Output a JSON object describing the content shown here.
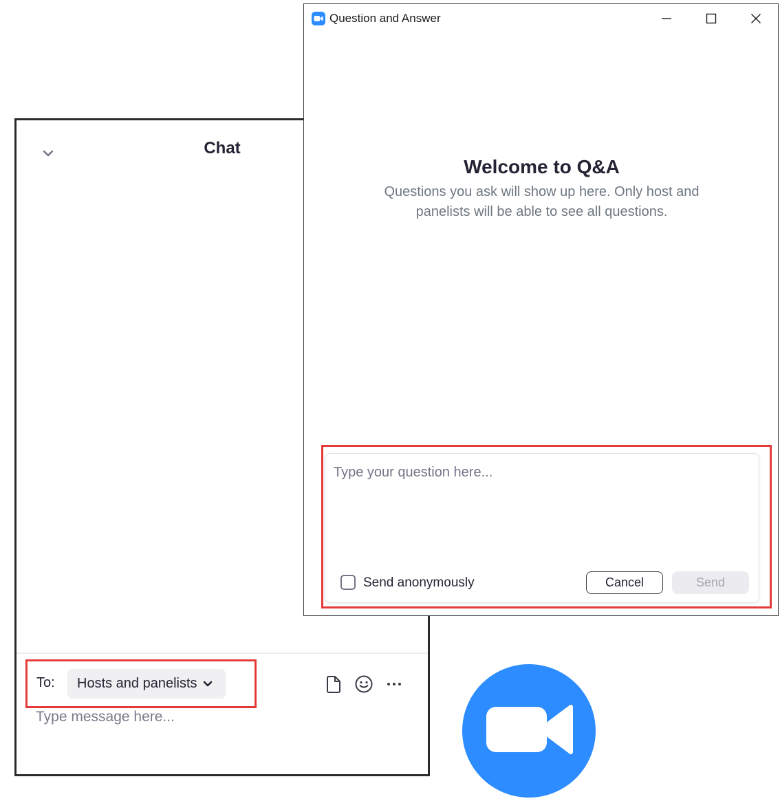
{
  "chat": {
    "title": "Chat",
    "to_label": "To:",
    "recipient": "Hosts and panelists",
    "input_placeholder": "Type message here..."
  },
  "qa": {
    "window_title": "Question and Answer",
    "welcome_title": "Welcome to Q&A",
    "welcome_description": "Questions you ask will show up here. Only host and panelists will be able to see all questions.",
    "question_placeholder": "Type your question here...",
    "anonymous_label": "Send anonymously",
    "anonymous_checked": false,
    "cancel_label": "Cancel",
    "send_label": "Send"
  },
  "icons": {
    "chat_collapse": "chevron-down-icon",
    "recipient_dropdown": "chevron-down-icon",
    "file": "file-icon",
    "emoji": "emoji-icon",
    "more": "more-icon",
    "qa_app": "zoom-icon",
    "minimize": "minimize-icon",
    "maximize": "maximize-icon",
    "close": "close-icon",
    "logo": "zoom-logo-icon"
  },
  "colors": {
    "accent": "#2d8cff",
    "highlight": "#e53a3a",
    "text": "#232333",
    "muted": "#6e7680"
  }
}
